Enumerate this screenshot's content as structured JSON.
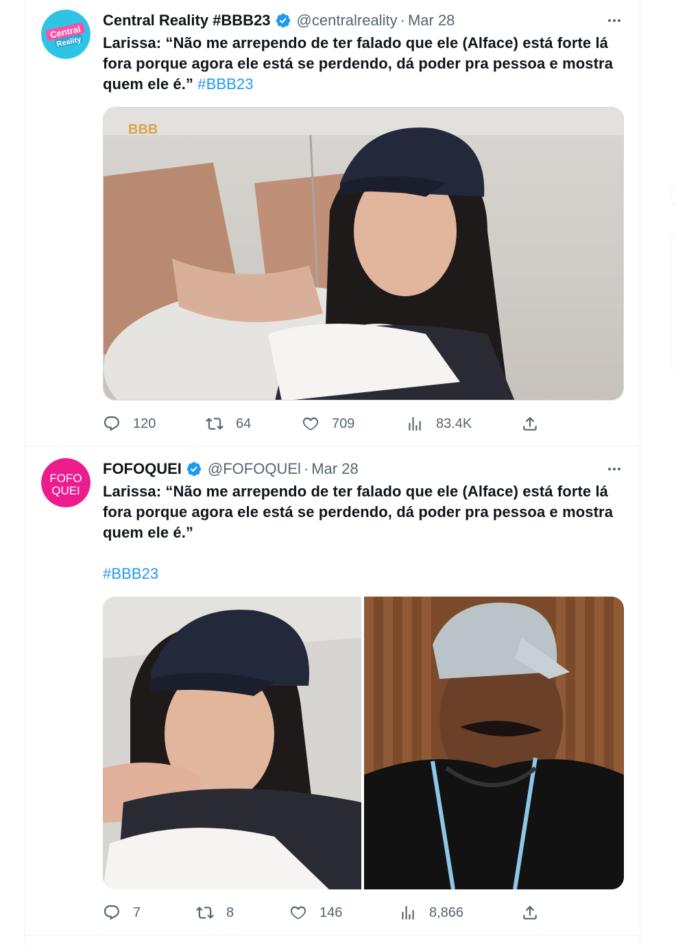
{
  "tweets": [
    {
      "author_name": "Central Reality #BBB23",
      "handle": "@centralreality",
      "separator": "·",
      "date": "Mar 28",
      "avatar_text_line1": "Central",
      "avatar_text_line2": "Reality",
      "text": "Larissa: “Não me arrependo de ter falado que ele (Alface) está forte lá fora porque agora ele está se perdendo, dá poder pra pessoa e mostra quem ele é.”",
      "hashtag": "#BBB23",
      "media_watermark": "BBB",
      "stats": {
        "replies": "120",
        "retweets": "64",
        "likes": "709",
        "views": "83.4K"
      }
    },
    {
      "author_name": "FOFOQUEI",
      "handle": "@FOFOQUEl",
      "separator": "·",
      "date": "Mar 28",
      "avatar_text_line1": "FOFO",
      "avatar_text_line2": "QUEI",
      "text": "Larissa: “Não me arrependo de ter falado que ele (Alface) está forte lá fora porque agora ele está se perdendo, dá poder pra pessoa e mostra quem ele é.”",
      "hashtag": "#BBB23",
      "stats": {
        "replies": "7",
        "retweets": "8",
        "likes": "146",
        "views": "8,866"
      }
    }
  ],
  "colors": {
    "accent": "#1d9bf0",
    "text": "#0f1419",
    "muted": "#536471",
    "border": "#eff3f4",
    "central_avatar": "#2ec4e6",
    "fofoquei_avatar": "#ec1c8f"
  },
  "icons": [
    "reply-icon",
    "retweet-icon",
    "like-icon",
    "views-icon",
    "share-icon",
    "verified-icon",
    "more-icon"
  ]
}
